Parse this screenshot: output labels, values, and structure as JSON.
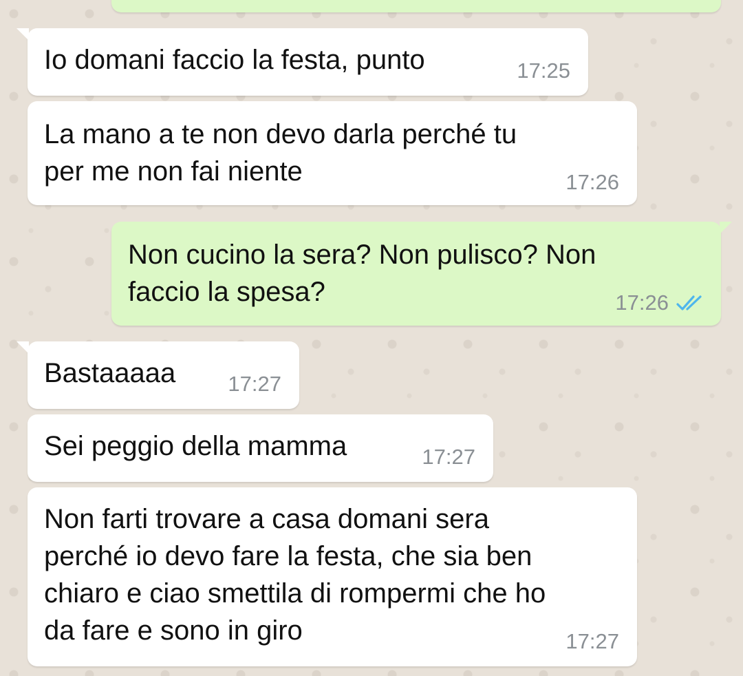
{
  "chat": {
    "messages": [
      {
        "side": "in",
        "lines": [
          "Io domani faccio la festa, punto"
        ],
        "time": "17:25"
      },
      {
        "side": "in",
        "lines": [
          "La mano a te non devo darla perché tu",
          "per me non fai niente"
        ],
        "time": "17:26"
      },
      {
        "side": "out",
        "lines": [
          "Non cucino la sera? Non pulisco? Non",
          "faccio la spesa?"
        ],
        "time": "17:26",
        "status": "read"
      },
      {
        "side": "in",
        "lines": [
          "Bastaaaaa"
        ],
        "time": "17:27"
      },
      {
        "side": "in",
        "lines": [
          "Sei peggio della mamma"
        ],
        "time": "17:27"
      },
      {
        "side": "in",
        "lines": [
          "Non farti trovare a casa domani sera",
          "perché io devo fare la festa, che sia ben",
          "chiaro e ciao smettila di rompermi che ho",
          "da fare e sono in giro"
        ],
        "time": "17:27"
      }
    ]
  },
  "icons": {
    "read_receipt": "double-check-icon"
  },
  "colors": {
    "incoming_bubble": "#ffffff",
    "outgoing_bubble": "#dcf8c6",
    "wallpaper": "#e8e1d8",
    "timestamp": "#8a8f94",
    "read_tick": "#4fb6ec"
  }
}
